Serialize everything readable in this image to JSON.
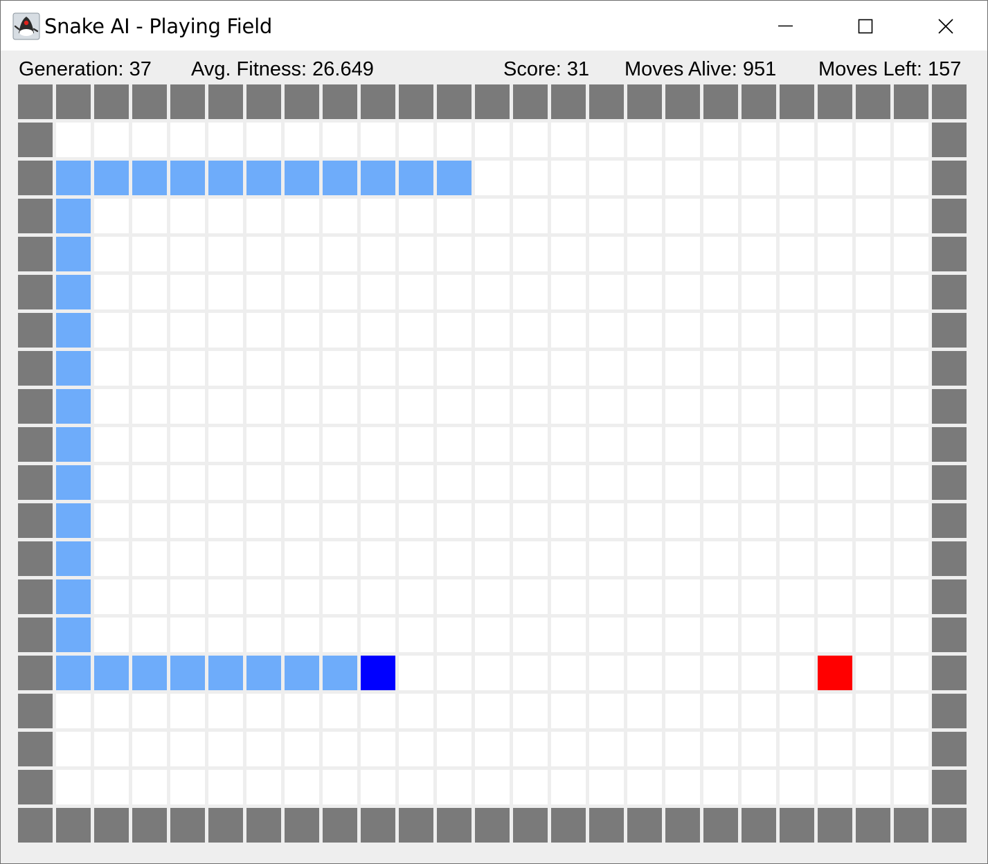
{
  "window": {
    "title": "Snake AI - Playing Field",
    "icon": "java-duke-icon",
    "controls": [
      "minimize-icon",
      "maximize-icon",
      "close-icon"
    ]
  },
  "stats": {
    "generation": "Generation: 37",
    "avg_fitness": "Avg. Fitness: 26.649",
    "score": "Score: 31",
    "moves_alive": "Moves Alive: 951",
    "moves_left": "Moves Left: 157"
  },
  "board": {
    "columns": 25,
    "rows": 20,
    "colors": {
      "wall": "#7a7a7a",
      "empty": "#ffffff",
      "snake_body": "#6eacfa",
      "snake_head": "#0000ff",
      "food": "#ff0000",
      "grid_line": "#eeeeee"
    },
    "snake_head": [
      9,
      15
    ],
    "snake_body": [
      [
        1,
        2
      ],
      [
        2,
        2
      ],
      [
        3,
        2
      ],
      [
        4,
        2
      ],
      [
        5,
        2
      ],
      [
        6,
        2
      ],
      [
        7,
        2
      ],
      [
        8,
        2
      ],
      [
        9,
        2
      ],
      [
        10,
        2
      ],
      [
        11,
        2
      ],
      [
        1,
        3
      ],
      [
        1,
        4
      ],
      [
        1,
        5
      ],
      [
        1,
        6
      ],
      [
        1,
        7
      ],
      [
        1,
        8
      ],
      [
        1,
        9
      ],
      [
        1,
        10
      ],
      [
        1,
        11
      ],
      [
        1,
        12
      ],
      [
        1,
        13
      ],
      [
        1,
        14
      ],
      [
        1,
        15
      ],
      [
        2,
        15
      ],
      [
        3,
        15
      ],
      [
        4,
        15
      ],
      [
        5,
        15
      ],
      [
        6,
        15
      ],
      [
        7,
        15
      ],
      [
        8,
        15
      ]
    ],
    "food": [
      21,
      15
    ]
  }
}
